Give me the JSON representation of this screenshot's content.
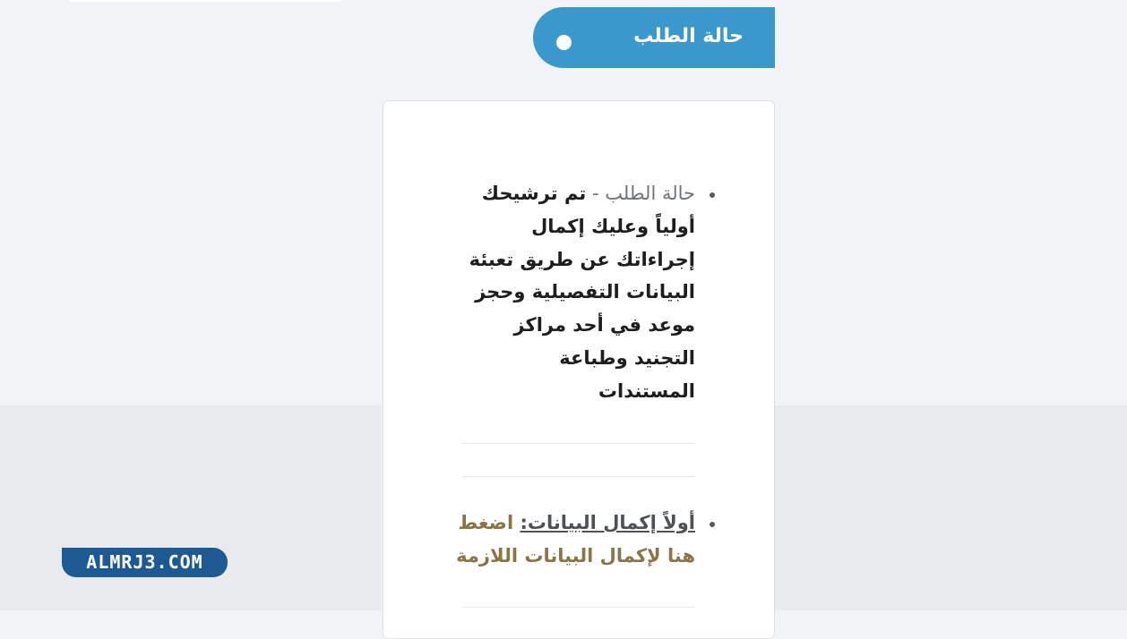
{
  "header": {
    "status_title": "حالة الطلب"
  },
  "items": [
    {
      "label": "حالة الطلب",
      "separator": " - ",
      "lines": [
        "تم ترشيحك",
        "أولياً وعليك إكمال",
        "إجراءاتك عن طريق تعبئة",
        "البيانات التفصيلية وحجز",
        "موعد في أحد مراكز",
        "التجنيد وطباعة",
        "المستندات"
      ]
    },
    {
      "link_title": "أولاً إكمال البيانات:",
      "link_line1": "اضغط",
      "link_line2": "هنا لإكمال البيانات اللازمة"
    }
  ],
  "logo": {
    "text": "ALMRJ3.COM"
  },
  "colors": {
    "accent_tab": "#3a98cd",
    "logo_bg": "#1d5a93",
    "link_color": "#8b7546"
  }
}
